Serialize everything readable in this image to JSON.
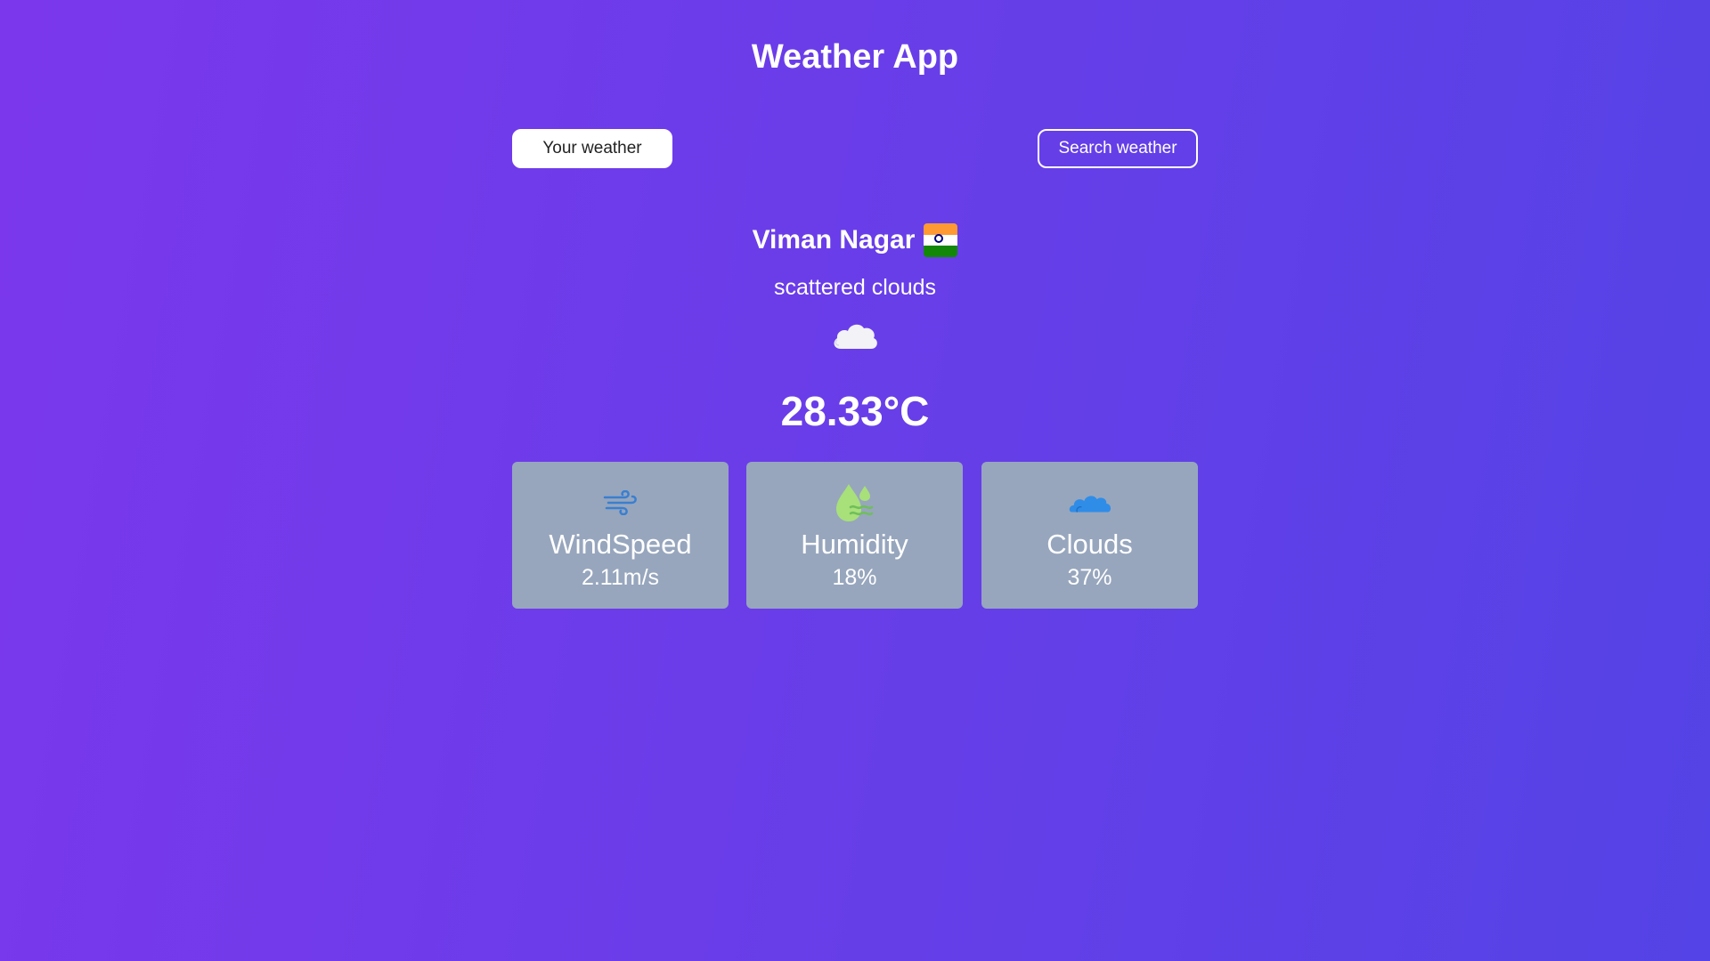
{
  "app": {
    "title": "Weather App"
  },
  "tabs": {
    "your_weather": "Your weather",
    "search_weather": "Search weather"
  },
  "weather": {
    "city": "Viman Nagar",
    "country_flag": "india-flag-icon",
    "description": "scattered clouds",
    "condition_icon": "cloud-icon",
    "temperature": "28.33°C"
  },
  "stats": {
    "windspeed": {
      "label": "WindSpeed",
      "value": "2.11m/s",
      "icon": "wind-icon"
    },
    "humidity": {
      "label": "Humidity",
      "value": "18%",
      "icon": "humidity-icon"
    },
    "clouds": {
      "label": "Clouds",
      "value": "37%",
      "icon": "clouds-icon"
    }
  },
  "colors": {
    "background_start": "#7b37ec",
    "background_end": "#5443e6",
    "card_background": "#97a6bd",
    "wind_icon": "#3a7fd0",
    "humidity_icon": "#a8e07a",
    "clouds_icon": "#2f8de8"
  }
}
